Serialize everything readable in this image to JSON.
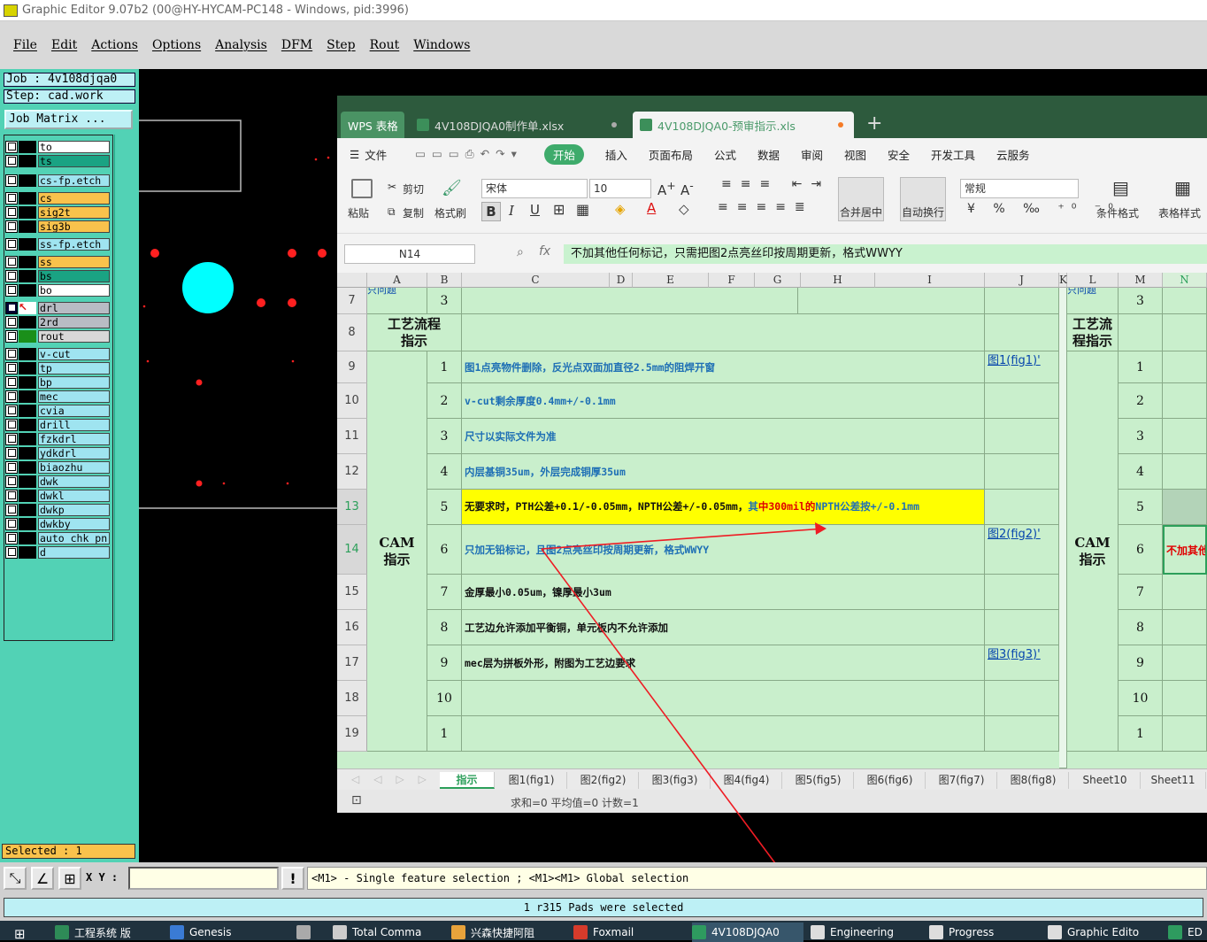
{
  "titlebar": {
    "text": "Graphic Editor 9.07b2 (00@HY-HYCAM-PC148 - Windows, pid:3996)"
  },
  "menu": [
    "File",
    "Edit",
    "Actions",
    "Options",
    "Analysis",
    "DFM",
    "Step",
    "Rout",
    "Windows"
  ],
  "job": {
    "job_label": "Job : 4v108djqa0",
    "step_label": "Step: cad.work",
    "matrix_button": "Job Matrix ..."
  },
  "layers": [
    {
      "name": "to",
      "color": "#ffffff",
      "group": 0
    },
    {
      "name": "ts",
      "color": "#1aa383",
      "group": 0
    },
    {
      "name": "cs-fp.etch",
      "color": "#9fe4f0",
      "group": 1
    },
    {
      "name": "cs",
      "color": "#f9c24c",
      "group": 2
    },
    {
      "name": "sig2t",
      "color": "#f9c24c",
      "group": 2
    },
    {
      "name": "sig3b",
      "color": "#f9c24c",
      "group": 2
    },
    {
      "name": "ss-fp.etch",
      "color": "#9fe4f0",
      "group": 3
    },
    {
      "name": "ss",
      "color": "#f9c24c",
      "group": 4
    },
    {
      "name": "bs",
      "color": "#1aa383",
      "group": 4
    },
    {
      "name": "bo",
      "color": "#ffffff",
      "group": 4
    },
    {
      "name": "drl",
      "color": "#b8bcc4",
      "group": 5,
      "active": true
    },
    {
      "name": "2rd",
      "color": "#b8bcc4",
      "group": 5
    },
    {
      "name": "rout",
      "color": "#d8d8d8",
      "group": 5
    },
    {
      "name": "v-cut",
      "color": "#9fe4f0",
      "group": 6
    },
    {
      "name": "tp",
      "color": "#9fe4f0",
      "group": 6
    },
    {
      "name": "bp",
      "color": "#9fe4f0",
      "group": 6
    },
    {
      "name": "mec",
      "color": "#9fe4f0",
      "group": 6
    },
    {
      "name": "cvia",
      "color": "#9fe4f0",
      "group": 6
    },
    {
      "name": "drill",
      "color": "#9fe4f0",
      "group": 6
    },
    {
      "name": "fzkdrl",
      "color": "#9fe4f0",
      "group": 6
    },
    {
      "name": "ydkdrl",
      "color": "#9fe4f0",
      "group": 6
    },
    {
      "name": "biaozhu",
      "color": "#9fe4f0",
      "group": 6
    },
    {
      "name": "dwk",
      "color": "#9fe4f0",
      "group": 6
    },
    {
      "name": "dwkl",
      "color": "#9fe4f0",
      "group": 6
    },
    {
      "name": "dwkp",
      "color": "#9fe4f0",
      "group": 6
    },
    {
      "name": "dwkby",
      "color": "#9fe4f0",
      "group": 6
    },
    {
      "name": "auto_chk_pn",
      "color": "#9fe4f0",
      "group": 6
    },
    {
      "name": "d",
      "color": "#9fe4f0",
      "group": 6
    }
  ],
  "selected": "Selected : 1",
  "wps": {
    "tab_home": "WPS 表格",
    "tab_file1": "4V108DJQA0制作单.xlsx",
    "tab_file2": "4V108DJQA0-预审指示.xls",
    "menus": [
      "文件",
      "开始",
      "插入",
      "页面布局",
      "公式",
      "数据",
      "审阅",
      "视图",
      "安全",
      "开发工具",
      "云服务"
    ],
    "ribbon": {
      "paste": "粘贴",
      "cut": "剪切",
      "copy": "复制",
      "format_painter": "格式刷",
      "font": "宋体",
      "size": "10",
      "merge": "合并居中",
      "wrap": "自动换行",
      "number_format": "常规",
      "cond_format": "条件格式",
      "table_style": "表格样式"
    },
    "namebox": "N14",
    "formula": "不加其他任何标记，只需把图2点亮丝印按周期更新，格式WWYY",
    "columns": [
      "A",
      "B",
      "C",
      "D",
      "E",
      "F",
      "G",
      "H",
      "I",
      "J",
      "K",
      "L",
      "M",
      "N"
    ],
    "row_numbers": [
      "7",
      "8",
      "9",
      "10",
      "11",
      "12",
      "13",
      "14",
      "15",
      "16",
      "17",
      "18",
      "19"
    ],
    "top_clip": "只问题",
    "section_process": "工艺流程指示",
    "section_cam": "CAM指示",
    "row7_num": "3",
    "tasks": [
      {
        "n": "1",
        "text": "图1点亮物件删除，反光点双面加直径2.5mm的阻焊开窗",
        "ref": "图1(fig1)'"
      },
      {
        "n": "2",
        "text": "v-cut剩余厚度0.4mm+/-0.1mm",
        "ref": ""
      },
      {
        "n": "3",
        "text": "尺寸以实际文件为准",
        "ref": ""
      },
      {
        "n": "4",
        "text": "内层基铜35um，外层完成铜厚35um",
        "ref": ""
      },
      {
        "n": "5",
        "text_a": "无要求时，PTH公差+0.1/-0.05mm，NPTH公差+/-0.05mm，",
        "text_b": "其",
        "text_c": "中300mil的",
        "text_d": "NPTH公差按+/-0.1mm",
        "ref": ""
      },
      {
        "n": "6",
        "text": "只加无铅标记，且图2点亮丝印按周期更新，格式WWYY",
        "ref": "图2(fig2)'"
      },
      {
        "n": "7",
        "text": "金厚最小0.05um，镍厚最小3um",
        "ref": ""
      },
      {
        "n": "8",
        "text": "工艺边允许添加平衡铜，单元板内不允许添加",
        "ref": ""
      },
      {
        "n": "9",
        "text": "mec层为拼板外形，附图为工艺边要求",
        "ref": "图3(fig3)'"
      },
      {
        "n": "10",
        "text": "",
        "ref": ""
      },
      {
        "n": "1",
        "text": "",
        "ref": ""
      }
    ],
    "right_nums": [
      "3",
      "",
      "1",
      "2",
      "3",
      "4",
      "5",
      "6",
      "7",
      "8",
      "9",
      "10",
      "1"
    ],
    "right_n14": "不加其他",
    "sheets": [
      "指示",
      "图1(fig1)",
      "图2(fig2)",
      "图3(fig3)",
      "图4(fig4)",
      "图5(fig5)",
      "图6(fig6)",
      "图7(fig7)",
      "图8(fig8)",
      "Sheet10",
      "Sheet11"
    ],
    "status": "求和=0  平均值=0  计数=1"
  },
  "bottom": {
    "xy_label": "X Y :",
    "hint": "<M1> - Single feature selection ; <M1><M1> Global selection",
    "message": "1 r315 Pads were selected"
  },
  "taskbar": [
    {
      "label": "工程系统 版",
      "color": "#2e8b57"
    },
    {
      "label": "Genesis",
      "color": "#3a7bd5"
    },
    {
      "label": "",
      "color": "#aaaaaa"
    },
    {
      "label": "Total Comma",
      "color": "#cccccc"
    },
    {
      "label": "兴森快捷阿阻",
      "color": "#e8a33b"
    },
    {
      "label": "Foxmail",
      "color": "#d63b2b"
    },
    {
      "label": "4V108DJQA0",
      "color": "#2e9b5f"
    },
    {
      "label": "Engineering",
      "color": "#dddddd"
    },
    {
      "label": "Progress",
      "color": "#dddddd"
    },
    {
      "label": "Graphic Edito",
      "color": "#dddddd"
    },
    {
      "label": "ED",
      "color": "#2e9b5f"
    }
  ]
}
